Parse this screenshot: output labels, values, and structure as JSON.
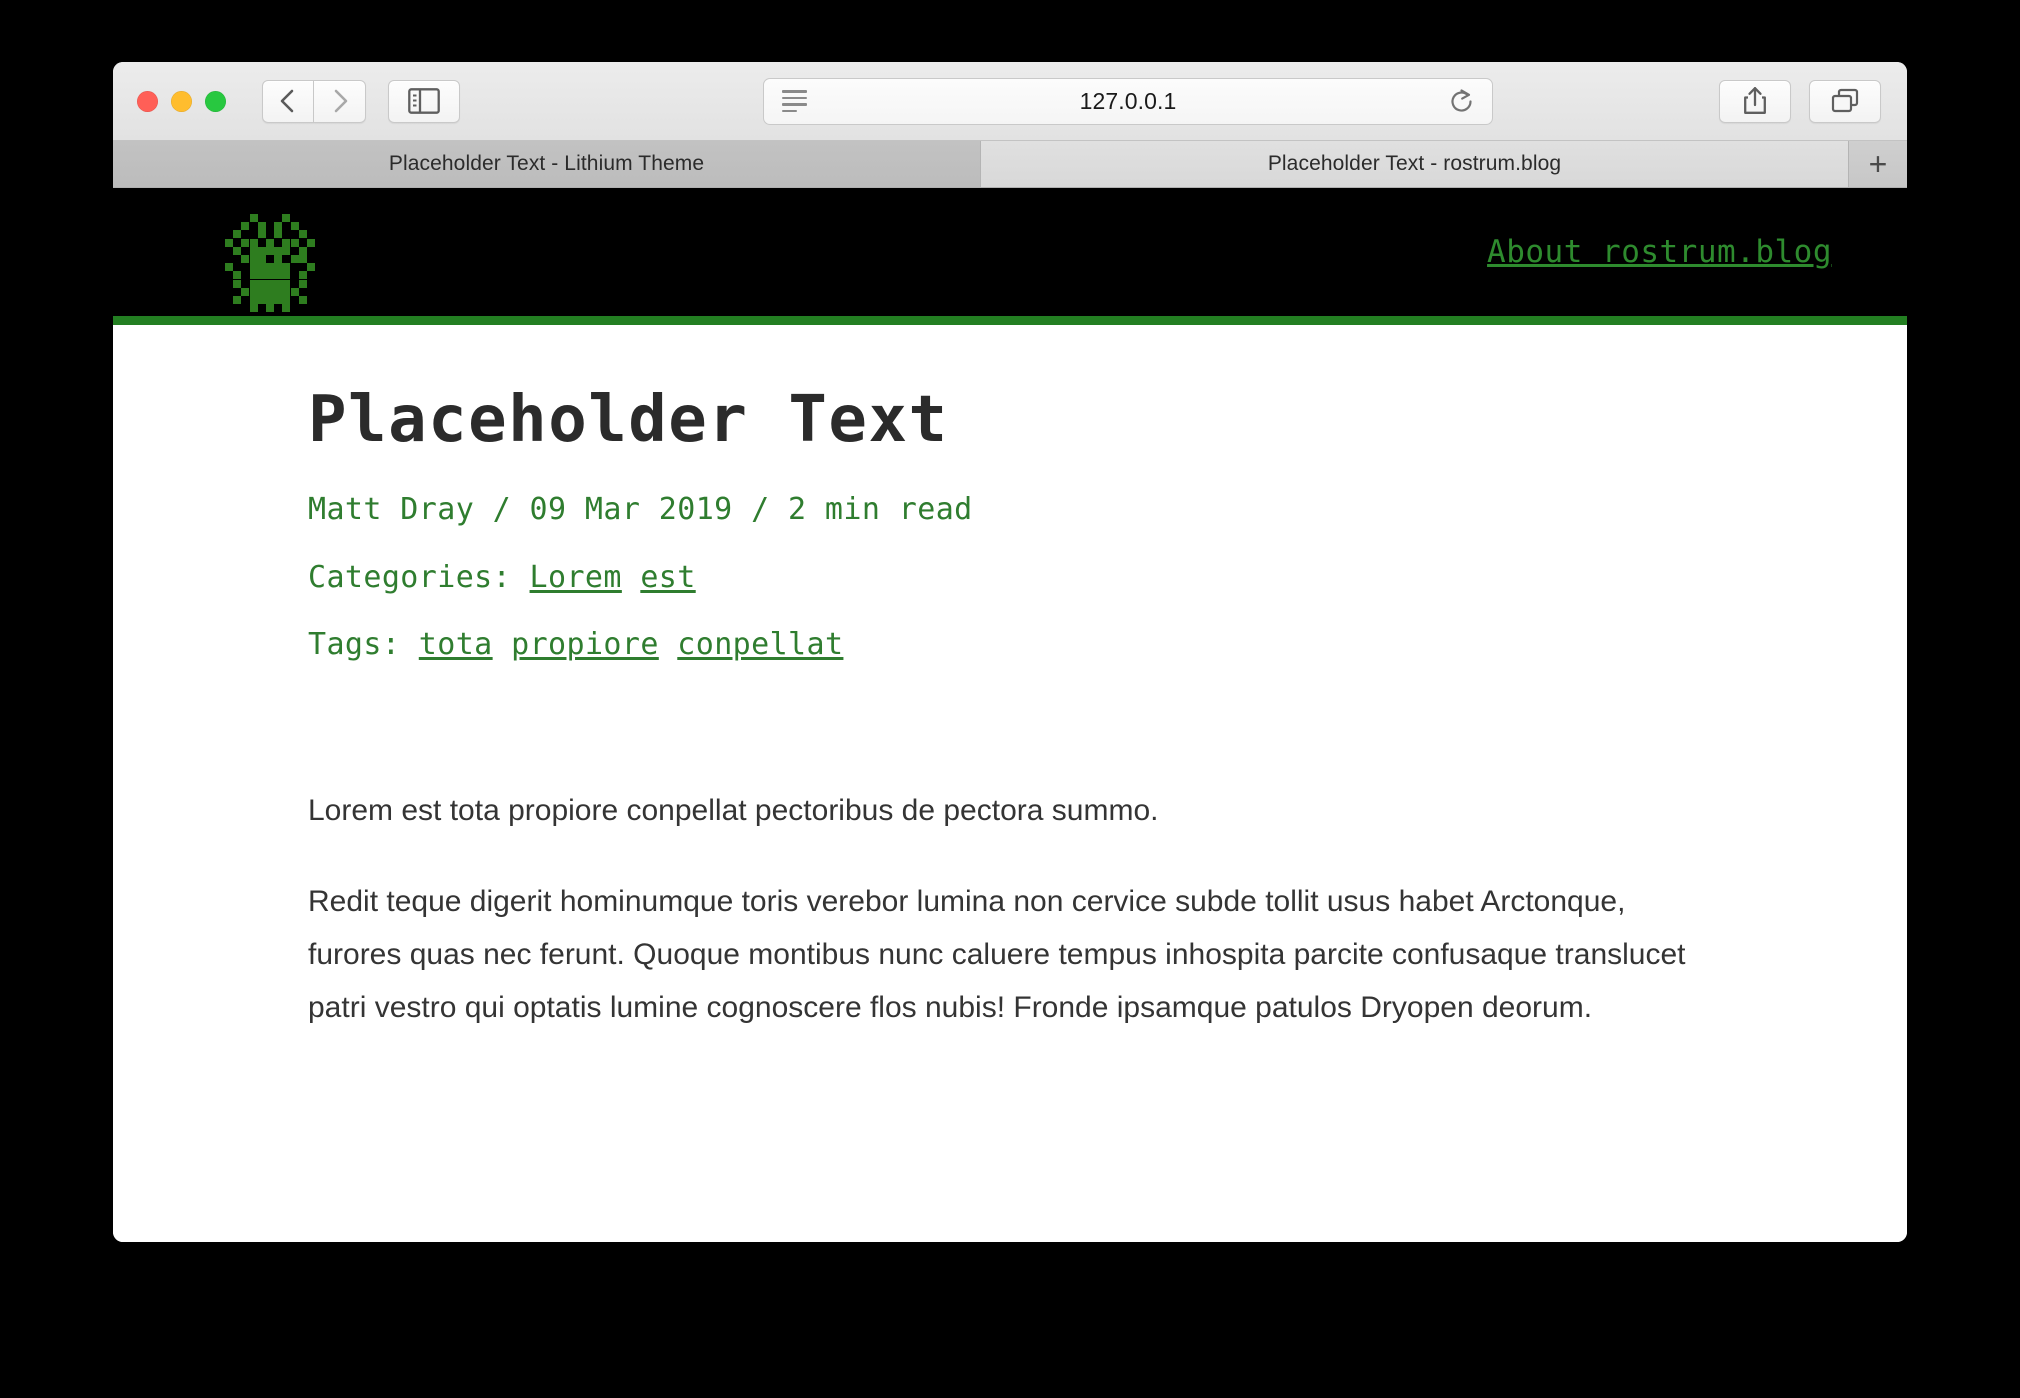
{
  "browser": {
    "window_buttons": [
      "close",
      "minimize",
      "maximize"
    ],
    "nav_back": "‹",
    "nav_forward": "›",
    "sidebar_icon": "sidebar-icon",
    "url": "127.0.0.1",
    "reader_icon": "reader-view-icon",
    "reload_icon": "reload-icon",
    "share_icon": "share-icon",
    "tab_overview_icon": "tab-overview-icon",
    "new_tab_label": "+",
    "tabs": [
      {
        "title": "Placeholder Text - Lithium Theme",
        "active": false
      },
      {
        "title": "Placeholder Text - rostrum.blog",
        "active": true
      }
    ]
  },
  "site": {
    "logo_alt": "pixel-beetle-logo",
    "nav_link": "About rostrum.blog",
    "accent_color": "#237f22",
    "nav_color": "#2e8b2e",
    "header_bg": "#000000"
  },
  "post": {
    "title": "Placeholder Text",
    "meta": "Matt Dray / 09 Mar 2019 / 2 min read",
    "author": "Matt Dray",
    "date": "09 Mar 2019",
    "read_time": "2 min read",
    "categories_label": "Categories:",
    "categories": [
      "Lorem",
      "est"
    ],
    "tags_label": "Tags:",
    "tags": [
      "tota",
      "propiore",
      "conpellat"
    ],
    "paragraphs": [
      "Lorem est tota propiore conpellat pectoribus de pectora summo.",
      "Redit teque digerit hominumque toris verebor lumina non cervice subde tollit usus habet Arctonque, furores quas nec ferunt. Quoque montibus nunc caluere tempus inhospita parcite confusaque translucet patri vestro qui optatis lumine cognoscere flos nubis! Fronde ipsamque patulos Dryopen deorum."
    ]
  }
}
